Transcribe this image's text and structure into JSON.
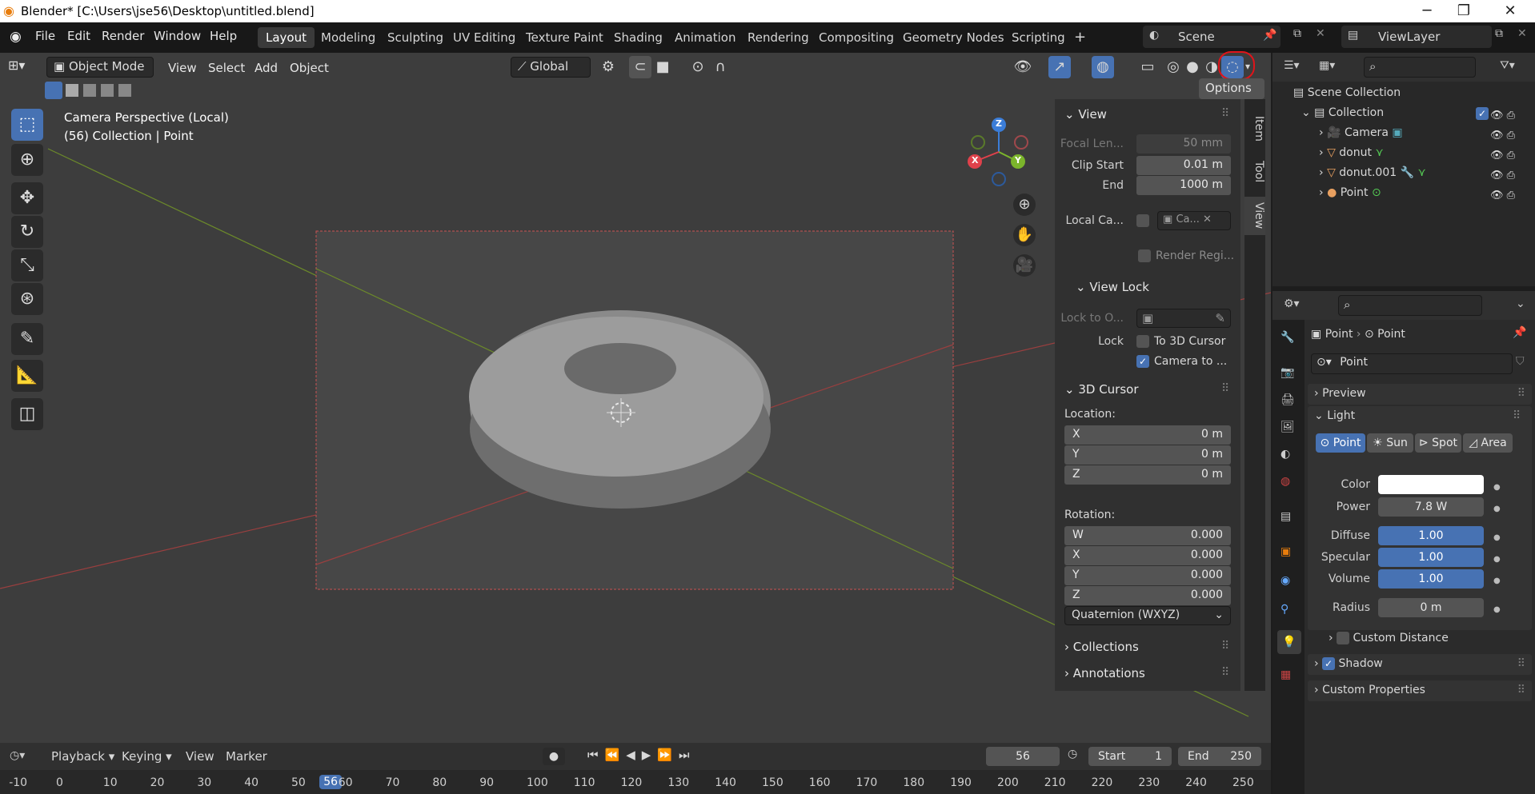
{
  "window": {
    "title": "Blender* [C:\\Users\\jse56\\Desktop\\untitled.blend]",
    "minimize": "─",
    "maximize": "❐",
    "close": "✕"
  },
  "menu": {
    "items": [
      "File",
      "Edit",
      "Render",
      "Window",
      "Help"
    ]
  },
  "workspaces": [
    "Layout",
    "Modeling",
    "Sculpting",
    "UV Editing",
    "Texture Paint",
    "Shading",
    "Animation",
    "Rendering",
    "Compositing",
    "Geometry Nodes",
    "Scripting"
  ],
  "add_workspace": "+",
  "scene": {
    "name": "Scene",
    "view_layer": "ViewLayer"
  },
  "viewport_header": {
    "mode": "Object Mode",
    "menus": [
      "View",
      "Select",
      "Add",
      "Object"
    ],
    "transform": "Global",
    "options": "Options"
  },
  "viewport": {
    "line1": "Camera Perspective (Local)",
    "line2": "(56) Collection | Point"
  },
  "gizmo": {
    "z": "Z",
    "y": "Y",
    "x": "X"
  },
  "sidebar": {
    "tabs": [
      "Item",
      "Tool",
      "View"
    ],
    "view_title": "View",
    "focal_label": "Focal Len...",
    "focal_val": "50 mm",
    "clip_start_label": "Clip Start",
    "clip_start_val": "0.01 m",
    "end_label": "End",
    "end_val": "1000 m",
    "local_cam_label": "Local Ca...",
    "local_cam_val": "Ca...",
    "render_region": "Render Regi...",
    "view_lock_title": "View Lock",
    "lock_obj_label": "Lock to O...",
    "lock_label": "Lock",
    "to_cursor": "To 3D Cursor",
    "camera_to": "Camera to ...",
    "cursor_title": "3D Cursor",
    "location_label": "Location:",
    "loc": [
      {
        "axis": "X",
        "val": "0 m"
      },
      {
        "axis": "Y",
        "val": "0 m"
      },
      {
        "axis": "Z",
        "val": "0 m"
      }
    ],
    "rotation_label": "Rotation:",
    "rot": [
      {
        "axis": "W",
        "val": "0.000"
      },
      {
        "axis": "X",
        "val": "0.000"
      },
      {
        "axis": "Y",
        "val": "0.000"
      },
      {
        "axis": "Z",
        "val": "0.000"
      }
    ],
    "rot_mode": "Quaternion (WXYZ)",
    "collections": "Collections",
    "annotations": "Annotations"
  },
  "outliner": {
    "root": "Scene Collection",
    "collection": "Collection",
    "items": [
      "Camera",
      "donut",
      "donut.001",
      "Point"
    ]
  },
  "properties": {
    "breadcrumb_obj": "Point",
    "breadcrumb_data": "Point",
    "datablock": "Point",
    "preview": "Preview",
    "light": "Light",
    "types": [
      "Point",
      "Sun",
      "Spot",
      "Area"
    ],
    "color_label": "Color",
    "power_label": "Power",
    "power_val": "7.8 W",
    "diffuse_label": "Diffuse",
    "diffuse_val": "1.00",
    "specular_label": "Specular",
    "specular_val": "1.00",
    "volume_label": "Volume",
    "volume_val": "1.00",
    "radius_label": "Radius",
    "radius_val": "0 m",
    "custom_distance": "Custom Distance",
    "shadow": "Shadow",
    "custom_props": "Custom Properties"
  },
  "timeline": {
    "menus": [
      "Playback",
      "Keying",
      "View",
      "Marker"
    ],
    "current": "56",
    "start_label": "Start",
    "start_val": "1",
    "end_label": "End",
    "end_val": "250",
    "ticks": [
      "-10",
      "0",
      "10",
      "20",
      "30",
      "40",
      "50",
      "56",
      "60",
      "70",
      "80",
      "90",
      "100",
      "110",
      "120",
      "130",
      "140",
      "150",
      "160",
      "170",
      "180",
      "190",
      "200",
      "210",
      "220",
      "230",
      "240",
      "250"
    ]
  },
  "colors": {
    "accent": "#4772b3",
    "highlight_circle": "#e0141a"
  }
}
